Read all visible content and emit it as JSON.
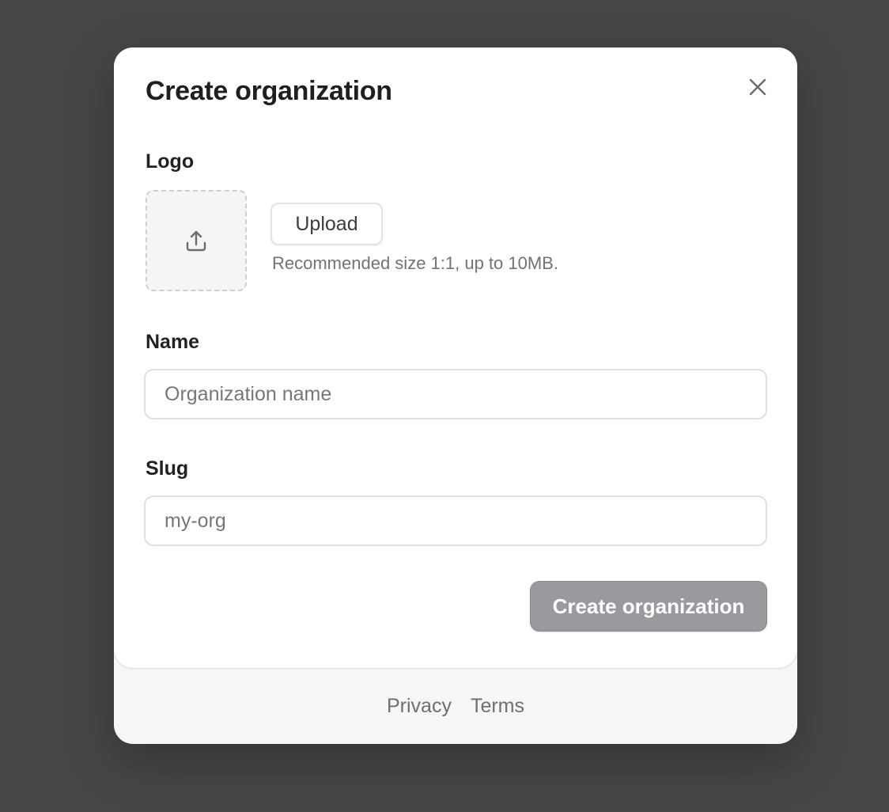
{
  "dialog": {
    "title": "Create organization",
    "close_icon": "close-icon"
  },
  "logo": {
    "label": "Logo",
    "upload_icon": "upload-icon",
    "upload_label": "Upload",
    "hint": "Recommended size 1:1, up to 10MB."
  },
  "name": {
    "label": "Name",
    "placeholder": "Organization name",
    "value": ""
  },
  "slug": {
    "label": "Slug",
    "placeholder": "my-org",
    "value": ""
  },
  "submit": {
    "label": "Create organization"
  },
  "footer": {
    "links": [
      "Privacy",
      "Terms"
    ]
  },
  "colors": {
    "backdrop": "#464646",
    "surface": "#ffffff",
    "footer_bg": "#f6f6f6",
    "disabled_button": "#9a9a9e"
  }
}
